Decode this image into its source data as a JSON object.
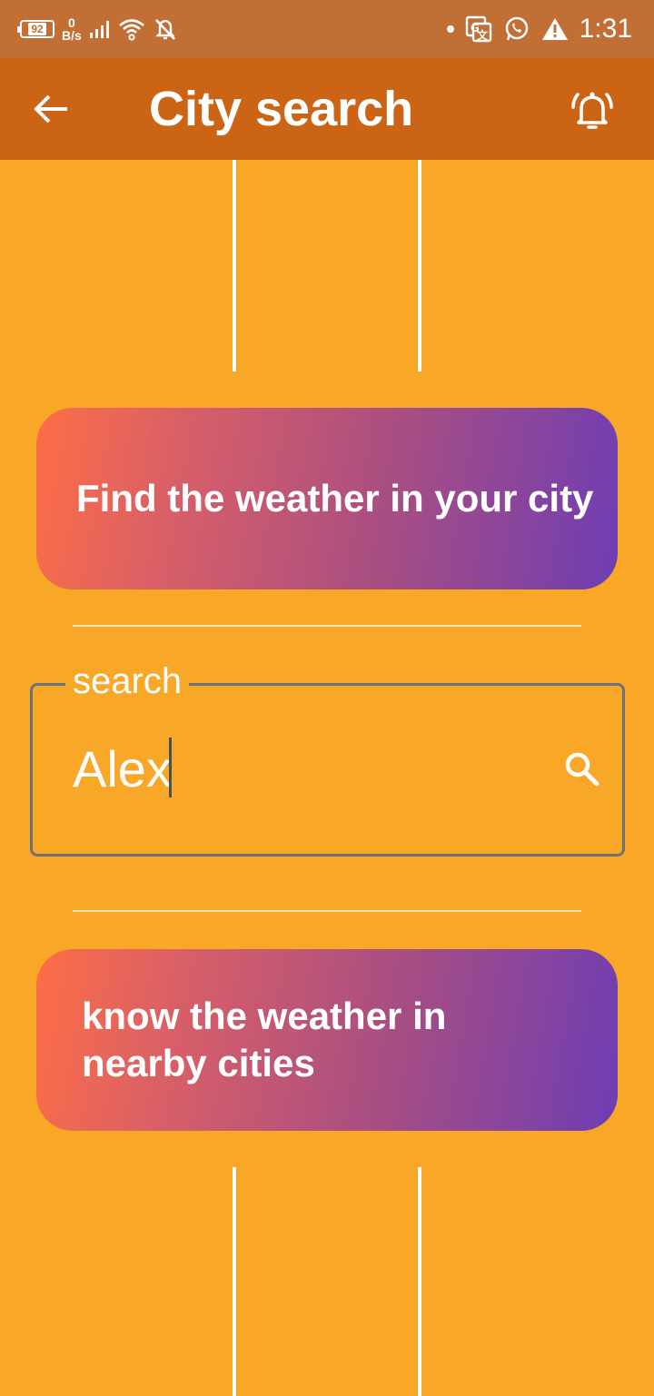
{
  "status_bar": {
    "battery": "92",
    "net_speed_value": "0",
    "net_speed_unit": "B/s",
    "time": "1:31"
  },
  "app_bar": {
    "title": "City search"
  },
  "find_card": {
    "label": "Find the weather in your city"
  },
  "search": {
    "label": "search",
    "value": "Alex"
  },
  "nearby_card": {
    "label": "know the weather in nearby cities"
  },
  "colors": {
    "background": "#F8A727",
    "app_bar": "#CB6414",
    "status_bar": "#C26F35",
    "gradient_start": "#FE6E45",
    "gradient_end": "#6E3DB4"
  },
  "icons": [
    "back-arrow-icon",
    "alarm-bell-icon",
    "search-icon",
    "wifi-icon",
    "signal-icon",
    "mute-bell-icon",
    "translate-icon",
    "whatsapp-icon",
    "warning-icon"
  ]
}
